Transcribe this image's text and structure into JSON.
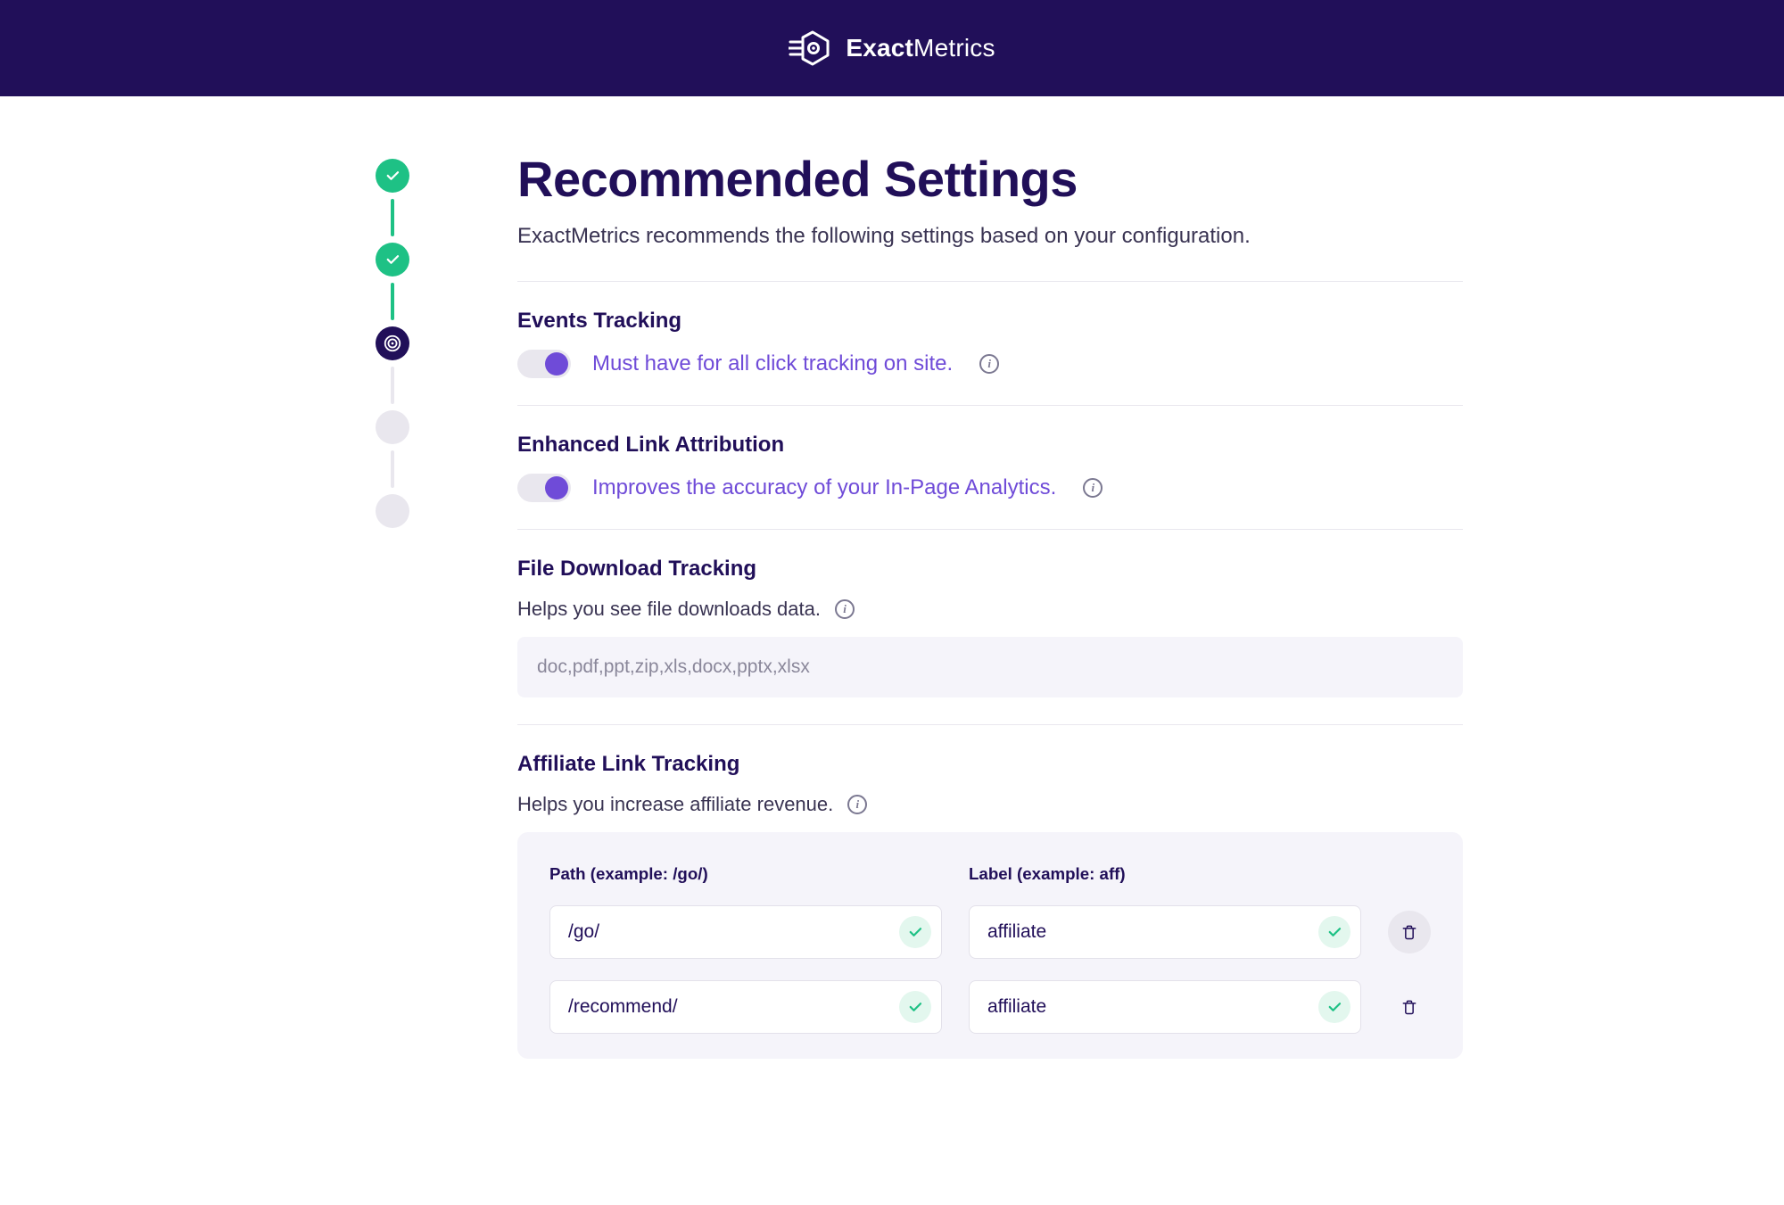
{
  "brand": {
    "name_bold": "Exact",
    "name_light": "Metrics"
  },
  "page": {
    "title": "Recommended Settings",
    "subtitle": "ExactMetrics recommends the following settings based on your configuration."
  },
  "sections": {
    "events": {
      "title": "Events Tracking",
      "desc": "Must have for all click tracking on site.",
      "on": true
    },
    "enhanced": {
      "title": "Enhanced Link Attribution",
      "desc": "Improves the accuracy of your In-Page Analytics.",
      "on": true
    },
    "downloads": {
      "title": "File Download Tracking",
      "helper": "Helps you see file downloads data.",
      "extensions": "doc,pdf,ppt,zip,xls,docx,pptx,xlsx"
    },
    "affiliate": {
      "title": "Affiliate Link Tracking",
      "helper": "Helps you increase affiliate revenue.",
      "path_header": "Path (example: /go/)",
      "label_header": "Label (example: aff)",
      "rows": [
        {
          "path": "/go/",
          "label": "affiliate"
        },
        {
          "path": "/recommend/",
          "label": "affiliate"
        }
      ]
    }
  }
}
